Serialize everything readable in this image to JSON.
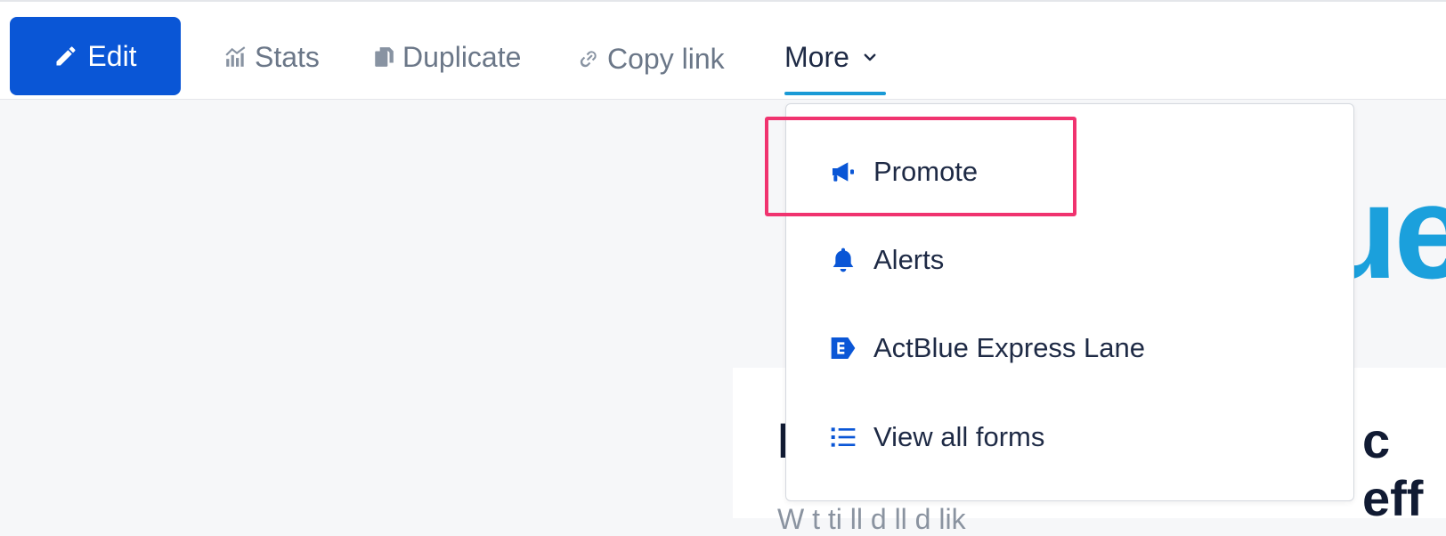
{
  "toolbar": {
    "edit_label": "Edit",
    "stats_label": "Stats",
    "duplicate_label": "Duplicate",
    "copy_link_label": "Copy link",
    "more_label": "More"
  },
  "dropdown": {
    "items": [
      {
        "label": "Promote",
        "icon": "megaphone-icon"
      },
      {
        "label": "Alerts",
        "icon": "bell-icon"
      },
      {
        "label": "ActBlue Express Lane",
        "icon": "express-lane-icon"
      },
      {
        "label": "View all forms",
        "icon": "list-icon"
      }
    ]
  },
  "background": {
    "headline_fragment": "ue",
    "card_title_left": "I",
    "card_title_right": "c eff",
    "card_subtitle": "W t        ti                ll d ll    d       lik"
  },
  "colors": {
    "primary": "#0a56d6",
    "accent_underline": "#1a9ad6",
    "highlight": "#f0336f"
  }
}
